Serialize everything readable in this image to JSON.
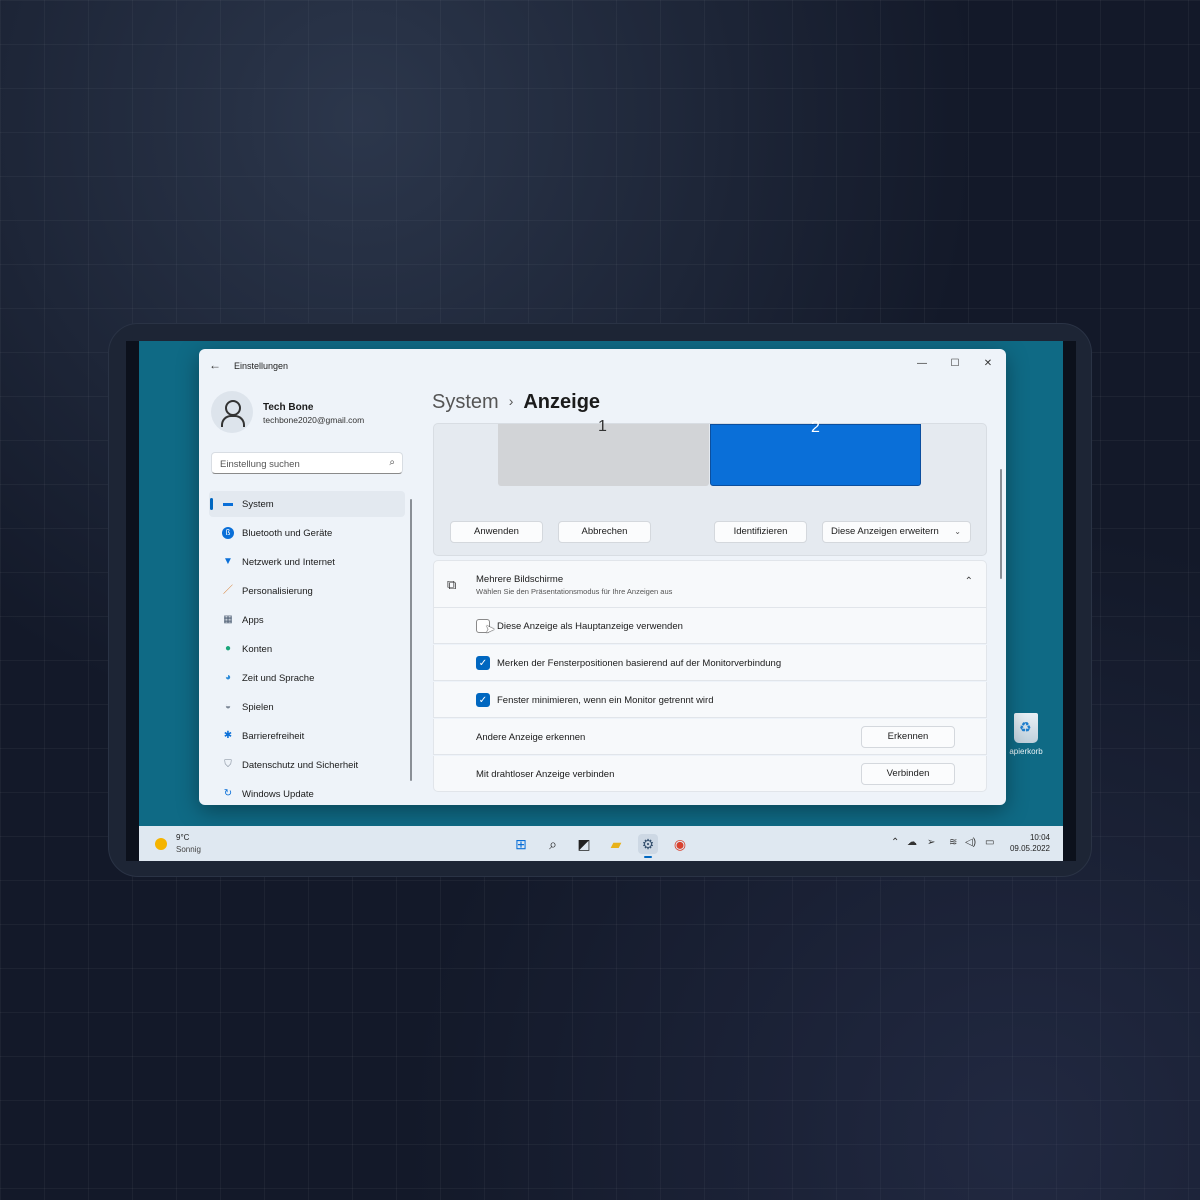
{
  "window": {
    "title": "Einstellungen",
    "back_icon": "arrow-left-icon",
    "controls": {
      "minimize": "—",
      "maximize": "☐",
      "close": "✕"
    }
  },
  "profile": {
    "name": "Tech Bone",
    "email": "techbone2020@gmail.com"
  },
  "search": {
    "placeholder": "Einstellung suchen",
    "icon": "search-icon"
  },
  "nav": {
    "items": [
      {
        "label": "System",
        "icon": "monitor-icon",
        "active": true
      },
      {
        "label": "Bluetooth und Geräte",
        "icon": "bluetooth-icon"
      },
      {
        "label": "Netzwerk und Internet",
        "icon": "wifi-icon"
      },
      {
        "label": "Personalisierung",
        "icon": "brush-icon"
      },
      {
        "label": "Apps",
        "icon": "apps-icon"
      },
      {
        "label": "Konten",
        "icon": "person-icon"
      },
      {
        "label": "Zeit und Sprache",
        "icon": "globe-clock-icon"
      },
      {
        "label": "Spielen",
        "icon": "gamepad-icon"
      },
      {
        "label": "Barrierefreiheit",
        "icon": "accessibility-icon"
      },
      {
        "label": "Datenschutz und Sicherheit",
        "icon": "shield-icon"
      },
      {
        "label": "Windows Update",
        "icon": "update-icon"
      }
    ]
  },
  "breadcrumb": {
    "parent": "System",
    "separator": "›",
    "current": "Anzeige"
  },
  "display": {
    "monitor1": "1",
    "monitor2": "2",
    "apply_label": "Anwenden",
    "cancel_label": "Abbrechen",
    "identify_label": "Identifizieren",
    "mode_select": "Diese Anzeigen erweitern"
  },
  "multi": {
    "title": "Mehrere Bildschirme",
    "subtitle": "Wählen Sie den Präsentationsmodus für Ihre Anzeigen aus",
    "opt_main": {
      "label": "Diese Anzeige als Hauptanzeige verwenden",
      "checked": false
    },
    "opt_remember": {
      "label": "Merken der Fensterpositionen basierend auf der Monitorverbindung",
      "checked": true
    },
    "opt_minimize": {
      "label": "Fenster minimieren, wenn ein Monitor getrennt wird",
      "checked": true
    },
    "detect": {
      "label": "Andere Anzeige erkennen",
      "button": "Erkennen"
    },
    "wireless": {
      "label": "Mit drahtloser Anzeige verbinden",
      "button": "Verbinden"
    }
  },
  "desktop": {
    "recycle_bin": "apierkorb"
  },
  "taskbar": {
    "weather_temp": "9°C",
    "weather_cond": "Sonnig",
    "time": "10:04",
    "date": "09.05.2022"
  },
  "colors": {
    "accent": "#0067c0",
    "monitor_selected": "#0a6fd8",
    "desktop": "#0f6a85"
  }
}
